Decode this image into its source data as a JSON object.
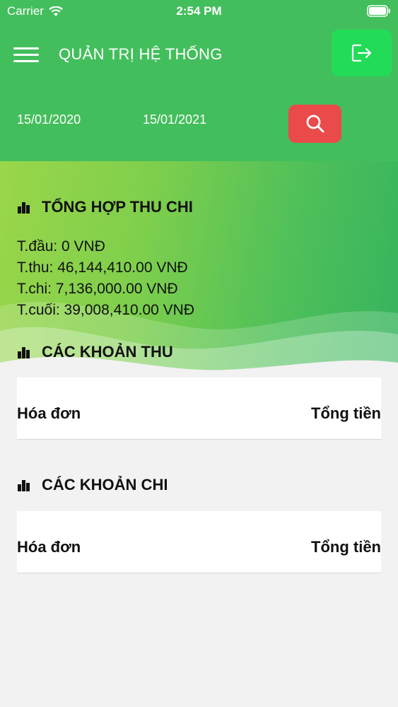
{
  "status_bar": {
    "carrier": "Carrier",
    "time": "2:54 PM"
  },
  "header": {
    "title": "QUẢN TRỊ HỆ THỐNG",
    "menu_icon": "hamburger-menu-icon",
    "logout_icon": "logout-icon",
    "date_from": "15/01/2020",
    "date_to": "15/01/2021",
    "search_icon": "search-icon"
  },
  "summary": {
    "heading": "TỔNG HỢP THU CHI",
    "opening": "T.đầu: 0 VNĐ",
    "income": "T.thu: 46,144,410.00 VNĐ",
    "expense": "T.chi: 7,136,000.00 VNĐ",
    "closing": "T.cuối: 39,008,410.00 VNĐ"
  },
  "income_section": {
    "heading": "CÁC KHOẢN THU",
    "columns": [
      "Hóa đơn",
      "Tổng tiền"
    ]
  },
  "expense_section": {
    "heading": "CÁC KHOẢN CHI",
    "columns": [
      "Hóa đơn",
      "Tổng tiền"
    ]
  },
  "colors": {
    "header_green": "#43be5c",
    "logout_button": "#22dc58",
    "search_button": "#ea4a4a",
    "background": "#f2f2f2"
  }
}
